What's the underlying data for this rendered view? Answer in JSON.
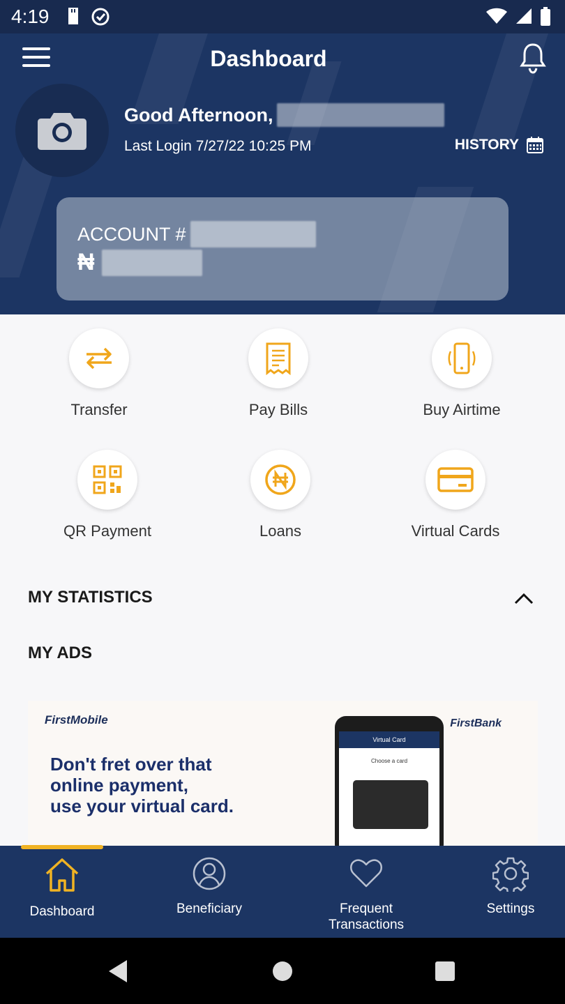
{
  "status_bar": {
    "time": "4:19"
  },
  "header": {
    "title": "Dashboard",
    "greeting": "Good Afternoon,",
    "last_login": "Last Login 7/27/22 10:25 PM",
    "history_label": "HISTORY"
  },
  "account": {
    "label": "ACCOUNT #",
    "currency_symbol": "₦"
  },
  "actions": [
    {
      "label": "Transfer",
      "icon": "transfer-arrows-icon"
    },
    {
      "label": "Pay Bills",
      "icon": "receipt-icon"
    },
    {
      "label": "Buy Airtime",
      "icon": "phone-ringing-icon"
    },
    {
      "label": "QR Payment",
      "icon": "qr-code-icon"
    },
    {
      "label": "Loans",
      "icon": "naira-coin-icon"
    },
    {
      "label": "Virtual Cards",
      "icon": "credit-card-icon"
    }
  ],
  "sections": {
    "statistics": "MY STATISTICS",
    "ads": "MY ADS"
  },
  "ad": {
    "brand": "FirstMobile",
    "bank": "FirstBank",
    "headline_1": "Don't fret over that",
    "headline_2": "online payment,",
    "headline_3": "use  your virtual card.",
    "screen_title": "Virtual Card",
    "screen_sub": "Choose a card"
  },
  "bottom_nav": [
    {
      "label": "Dashboard",
      "icon": "home-icon",
      "active": true
    },
    {
      "label": "Beneficiary",
      "icon": "user-icon",
      "active": false
    },
    {
      "label": "Frequent",
      "label2": "Transactions",
      "icon": "heart-icon",
      "active": false
    },
    {
      "label": "Settings",
      "icon": "gear-icon",
      "active": false
    }
  ],
  "colors": {
    "navy": "#1c3563",
    "accent": "#f0b323"
  }
}
